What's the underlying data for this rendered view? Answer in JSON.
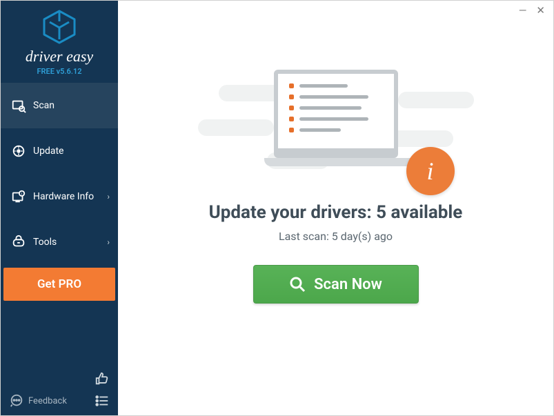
{
  "brand": {
    "name": "driver easy",
    "version": "FREE v5.6.12"
  },
  "sidebar": {
    "items": [
      {
        "label": "Scan",
        "icon": "scan-icon",
        "has_submenu": false,
        "active": true
      },
      {
        "label": "Update",
        "icon": "update-icon",
        "has_submenu": false,
        "active": false
      },
      {
        "label": "Hardware Info",
        "icon": "hardware-icon",
        "has_submenu": true,
        "active": false
      },
      {
        "label": "Tools",
        "icon": "tools-icon",
        "has_submenu": true,
        "active": false
      }
    ],
    "get_pro": "Get PRO",
    "feedback": "Feedback"
  },
  "main": {
    "headline_prefix": "Update your drivers: ",
    "available_count": 5,
    "headline_suffix": " available",
    "last_scan": "Last scan: 5 day(s) ago",
    "scan_button": "Scan Now"
  },
  "colors": {
    "sidebar_bg": "#143553",
    "accent_orange": "#f37b33",
    "accent_green": "#4ea94d",
    "brand_cyan": "#2fa0d8",
    "headline": "#3f4d58"
  }
}
